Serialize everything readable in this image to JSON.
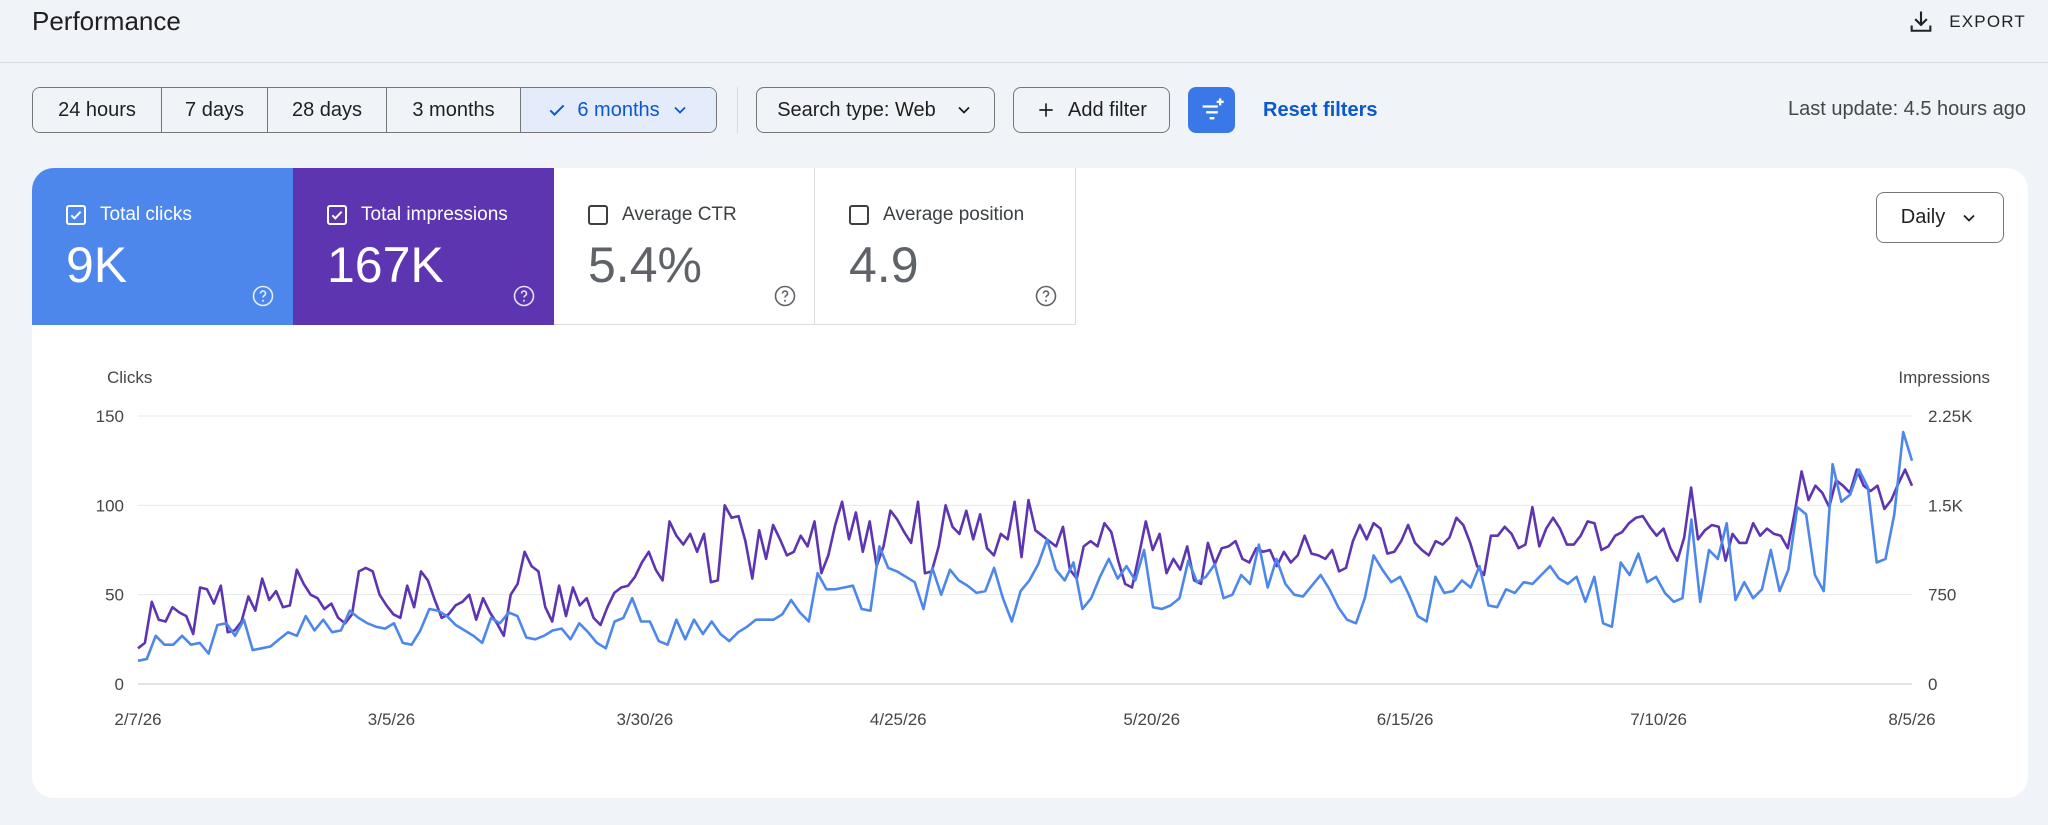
{
  "header": {
    "title": "Performance",
    "export_label": "EXPORT"
  },
  "filters": {
    "ranges": [
      "24 hours",
      "7 days",
      "28 days",
      "3 months",
      "6 months"
    ],
    "selected_range": "6 months",
    "search_type": "Search type: Web",
    "add_filter": "Add filter",
    "reset": "Reset filters",
    "last_update": "Last update: 4.5 hours ago"
  },
  "metrics": [
    {
      "label": "Total clicks",
      "value": "9K",
      "checked": true,
      "color": "#4e87ec"
    },
    {
      "label": "Total impressions",
      "value": "167K",
      "checked": true,
      "color": "#5e35b1"
    },
    {
      "label": "Average CTR",
      "value": "5.4%",
      "checked": false
    },
    {
      "label": "Average position",
      "value": "4.9",
      "checked": false
    }
  ],
  "granularity": "Daily",
  "chart_data": {
    "type": "line",
    "left_axis_label": "Clicks",
    "right_axis_label": "Impressions",
    "left_ticks": [
      "0",
      "50",
      "100",
      "150"
    ],
    "right_ticks": [
      "0",
      "750",
      "1.5K",
      "2.25K"
    ],
    "ylim_left": [
      0,
      150
    ],
    "ylim_right": [
      0,
      2250
    ],
    "x_start": "2/7/26",
    "x_end": "8/5/26",
    "x_tick_labels": [
      "2/7/26",
      "3/5/26",
      "3/30/26",
      "4/25/26",
      "5/20/26",
      "6/15/26",
      "7/10/26",
      "8/5/26"
    ],
    "grid": true,
    "series": [
      {
        "name": "Clicks",
        "axis": "left",
        "color": "#4e87ec",
        "values": [
          13,
          14,
          27,
          22,
          22,
          27,
          22,
          23,
          17,
          33,
          34,
          27,
          36,
          19,
          20,
          21,
          25,
          29,
          27,
          38,
          30,
          36,
          29,
          30,
          41,
          37,
          34,
          32,
          31,
          34,
          23,
          22,
          30,
          42,
          41,
          38,
          33,
          30,
          27,
          23,
          37,
          34,
          40,
          38,
          26,
          25,
          27,
          30,
          31,
          25,
          34,
          29,
          23,
          20,
          35,
          37,
          48,
          35,
          35,
          24,
          22,
          36,
          25,
          36,
          28,
          35,
          28,
          24,
          29,
          32,
          36,
          36,
          36,
          39,
          47,
          40,
          35,
          62,
          53,
          53,
          54,
          55,
          42,
          41,
          77,
          65,
          63,
          60,
          57,
          42,
          65,
          50,
          64,
          58,
          55,
          51,
          52,
          65,
          48,
          35,
          52,
          58,
          67,
          81,
          64,
          58,
          68,
          42,
          48,
          60,
          70,
          59,
          66,
          58,
          75,
          43,
          42,
          44,
          48,
          69,
          57,
          60,
          67,
          48,
          50,
          61,
          56,
          78,
          54,
          70,
          56,
          50,
          49,
          55,
          61,
          53,
          43,
          36,
          34,
          48,
          72,
          64,
          57,
          60,
          50,
          38,
          35,
          60,
          51,
          52,
          58,
          54,
          66,
          44,
          43,
          53,
          51,
          57,
          56,
          61,
          66,
          59,
          56,
          60,
          46,
          60,
          34,
          32,
          68,
          61,
          73,
          57,
          60,
          51,
          46,
          48,
          92,
          46,
          75,
          70,
          90,
          47,
          57,
          48,
          53,
          75,
          52,
          64,
          99,
          95,
          61,
          52,
          123,
          102,
          106,
          120,
          110,
          68,
          70,
          95,
          141,
          125
        ]
      },
      {
        "name": "Impressions",
        "axis": "right",
        "color": "#5e35b1",
        "values": [
          300,
          345,
          690,
          540,
          525,
          645,
          600,
          570,
          420,
          810,
          795,
          675,
          825,
          435,
          450,
          525,
          735,
          615,
          885,
          705,
          780,
          645,
          660,
          960,
          840,
          750,
          720,
          630,
          675,
          555,
          510,
          585,
          945,
          975,
          945,
          750,
          660,
          585,
          555,
          825,
          645,
          945,
          870,
          705,
          555,
          585,
          660,
          690,
          750,
          540,
          720,
          600,
          510,
          405,
          750,
          840,
          1110,
          990,
          945,
          645,
          525,
          825,
          570,
          810,
          660,
          720,
          555,
          495,
          645,
          765,
          810,
          825,
          900,
          1020,
          1110,
          960,
          870,
          1365,
          1245,
          1170,
          1260,
          1110,
          1260,
          855,
          870,
          1500,
          1395,
          1410,
          1200,
          885,
          1290,
          1050,
          1335,
          1215,
          1080,
          1110,
          1245,
          1155,
          1365,
          930,
          1080,
          1335,
          1530,
          1215,
          1440,
          1110,
          1365,
          990,
          1155,
          1455,
          1380,
          1275,
          1185,
          1530,
          930,
          945,
          1155,
          1500,
          1320,
          1260,
          1455,
          1215,
          1425,
          1140,
          1080,
          1260,
          1215,
          1530,
          1065,
          1545,
          1290,
          1245,
          1200,
          1155,
          1320,
          960,
          885,
          1155,
          1200,
          1155,
          1350,
          1275,
          1035,
          840,
          810,
          1080,
          1365,
          1125,
          1260,
          930,
          1050,
          960,
          1155,
          870,
          840,
          1185,
          1005,
          1140,
          1155,
          1200,
          1050,
          1020,
          1140,
          1110,
          1125,
          990,
          1110,
          1020,
          1080,
          1245,
          1095,
          1080,
          1050,
          1125,
          945,
          975,
          1200,
          1335,
          1215,
          1350,
          1305,
          1095,
          1110,
          1200,
          1335,
          1185,
          1125,
          1080,
          1200,
          1170,
          1230,
          1395,
          1335,
          1185,
          990,
          915,
          1245,
          1245,
          1320,
          1260,
          1140,
          1170,
          1485,
          1155,
          1305,
          1395,
          1305,
          1170,
          1170,
          1245,
          1365,
          1350,
          1125,
          1155,
          1245,
          1275,
          1350,
          1395,
          1410,
          1320,
          1245,
          1305,
          1140,
          1035,
          1230,
          1650,
          1215,
          1290,
          1335,
          1320,
          1035,
          1260,
          1185,
          1185,
          1350,
          1245,
          1305,
          1260,
          1245,
          1140,
          1440,
          1785,
          1545,
          1665,
          1605,
          1485,
          1710,
          1665,
          1605,
          1800,
          1665,
          1620,
          1665,
          1470,
          1545,
          1680,
          1800,
          1665
        ]
      }
    ]
  }
}
